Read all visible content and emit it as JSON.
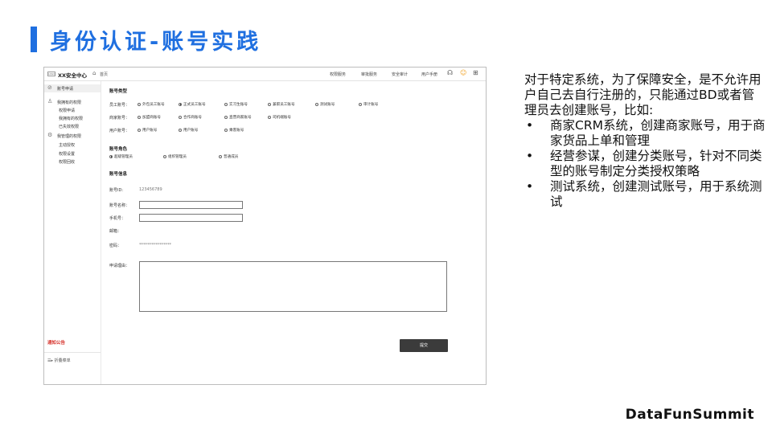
{
  "slide": {
    "title": "身份认证-账号实践",
    "brand": "DataFunSummit",
    "accent_color": "#1f6fe0"
  },
  "app": {
    "logo_text": "LOGO",
    "name": "XX安全中心",
    "home_icon": "home-icon",
    "home_label": "首页",
    "nav": [
      "权限服务",
      "审批服务",
      "安全审计",
      "用户手册"
    ],
    "icons": [
      "headset-icon",
      "user-icon",
      "grid-icon"
    ]
  },
  "sidebar": {
    "items": [
      {
        "label": "账号申请",
        "icon": "check-circle-icon",
        "active": true
      },
      {
        "label": "我拥有的权限",
        "icon": "user-icon"
      },
      {
        "label": "权限申请"
      },
      {
        "label": "我拥有的权限"
      },
      {
        "label": "已失效权限"
      },
      {
        "label": "我管理的权限",
        "icon": "settings-icon"
      },
      {
        "label": "主动授权"
      },
      {
        "label": "权限设置"
      },
      {
        "label": "权限回收"
      }
    ],
    "notice": "通知公告",
    "collapse": "折叠菜单",
    "collapse_icon": "collapse-menu-icon"
  },
  "form": {
    "account_type_title": "账号类型",
    "employee_label": "员工账号：",
    "employee_options": [
      {
        "label": "外包员工账号",
        "checked": false
      },
      {
        "label": "正式员工账号",
        "checked": true
      },
      {
        "label": "实习生账号",
        "checked": false
      },
      {
        "label": "兼职员工账号",
        "checked": false
      },
      {
        "label": "测试账号",
        "checked": false
      },
      {
        "label": "审计账号",
        "checked": false
      }
    ],
    "merchant_label": "商家账号：",
    "merchant_options": [
      {
        "label": "加盟商账号",
        "checked": false
      },
      {
        "label": "合作商账号",
        "checked": false
      },
      {
        "label": "直营商家账号",
        "checked": false
      },
      {
        "label": "司机端账号",
        "checked": false
      }
    ],
    "user_label": "用户账号：",
    "user_options": [
      {
        "label": "用户账号",
        "checked": false
      },
      {
        "label": "用户账号",
        "checked": false
      },
      {
        "label": "乘客账号",
        "checked": false
      }
    ],
    "role_title": "账号角色",
    "role_options": [
      {
        "label": "超级管理员",
        "checked": true
      },
      {
        "label": "组织管理员",
        "checked": false
      },
      {
        "label": "普通成员",
        "checked": false
      }
    ],
    "info_title": "账号信息",
    "id_label": "账号ID:",
    "id_value": "123456789",
    "name_label": "账号名称：",
    "name_value": "",
    "phone_label": "手机号：",
    "phone_value": "",
    "email_label": "邮箱：",
    "password_label": "密码：",
    "password_value": "****************",
    "reason_label": "申请理由：",
    "reason_value": "",
    "submit_label": "提交"
  },
  "description": {
    "intro": "对于特定系统，为了保障安全，是不允许用户自己去自行注册的，只能通过BD或者管理员去创建账号，比如:",
    "bullets": [
      "商家CRM系统，创建商家账号，用于商家货品上单和管理",
      "经营参谋，创建分类账号，针对不同类型的账号制定分类授权策略",
      "测试系统，创建测试账号，用于系统测试"
    ]
  }
}
